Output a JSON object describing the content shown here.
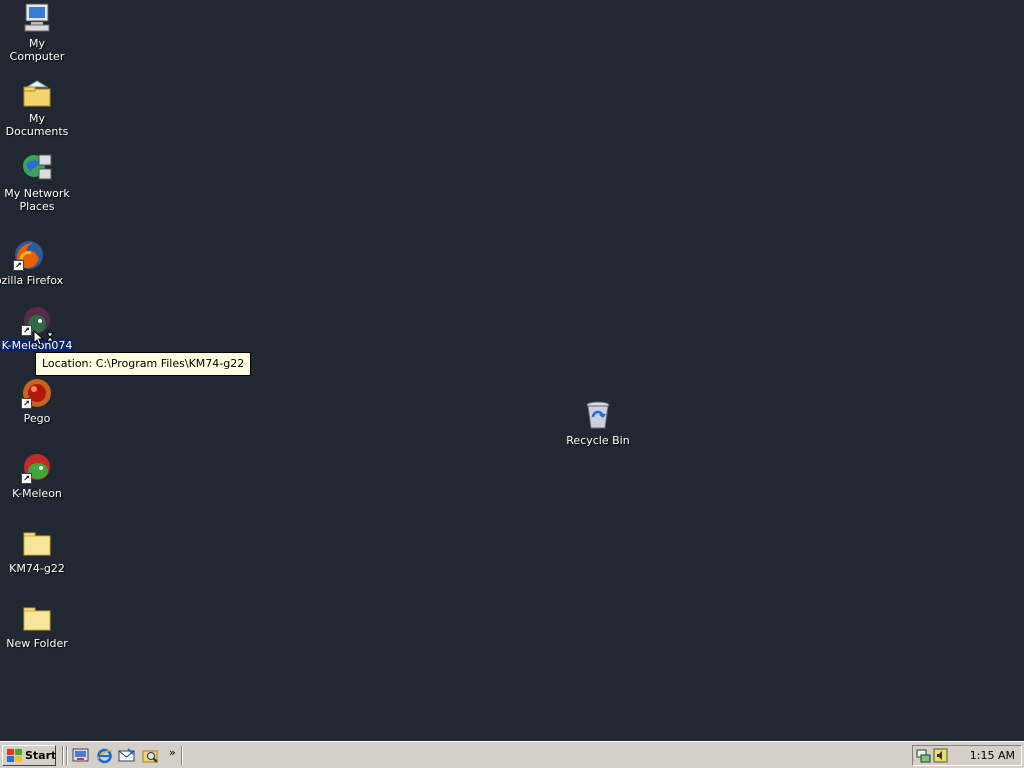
{
  "desktop": {
    "background": "#222831",
    "icons": [
      {
        "label": "My Computer",
        "icon": "my-computer-icon"
      },
      {
        "label": "My Documents",
        "icon": "my-documents-icon"
      },
      {
        "label": "My Network Places",
        "icon": "network-places-icon"
      },
      {
        "label": "ozilla Firefox",
        "icon": "firefox-icon",
        "shortcut": true
      },
      {
        "label": "K-Meleon074",
        "icon": "k-meleon074-icon",
        "shortcut": true,
        "selected": true
      },
      {
        "label": "Pego",
        "icon": "pego-icon",
        "shortcut": true
      },
      {
        "label": "K-Meleon",
        "icon": "k-meleon-icon",
        "shortcut": true
      },
      {
        "label": "KM74-g22",
        "icon": "folder-icon"
      },
      {
        "label": "New Folder",
        "icon": "folder-icon"
      },
      {
        "label": "Recycle Bin",
        "icon": "recycle-bin-icon"
      }
    ],
    "tooltip": "Location: C:\\Program Files\\KM74-g22"
  },
  "taskbar": {
    "start_label": "Start",
    "quick_launch": [
      "show-desktop-icon",
      "internet-explorer-icon",
      "outlook-express-icon",
      "explorer-search-icon"
    ],
    "chevron": "»",
    "tray_icons": [
      "network-tray-icon",
      "volume-tray-icon"
    ],
    "clock": "1:15 AM"
  }
}
